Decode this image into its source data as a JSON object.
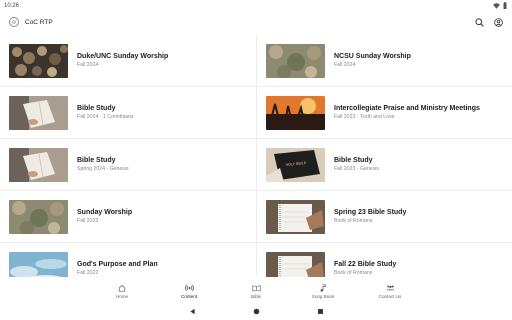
{
  "status": {
    "time": "10:26"
  },
  "app": {
    "title": "CoC RTP",
    "logo_icon": "coc-logo-icon"
  },
  "top_actions": [
    {
      "icon": "search-icon"
    },
    {
      "icon": "account-icon"
    }
  ],
  "left_items": [
    {
      "title": "Duke/UNC Sunday Worship",
      "subtitle": "Fall 2024",
      "thumb": "logs"
    },
    {
      "title": "Bible Study",
      "subtitle": "Fall 2024 - 1 Corinthians",
      "thumb": "reading"
    },
    {
      "title": "Bible Study",
      "subtitle": "Spring 2024 - Genesis",
      "thumb": "reading"
    },
    {
      "title": "Sunday Worship",
      "subtitle": "Fall 2023",
      "thumb": "moss"
    },
    {
      "title": "God's Purpose and Plan",
      "subtitle": "Fall 2022",
      "thumb": "sky"
    }
  ],
  "right_items": [
    {
      "title": "NCSU Sunday Worship",
      "subtitle": "Fall 2024",
      "thumb": "moss"
    },
    {
      "title": "Intercollegiate Praise and Ministry Meetings",
      "subtitle": "Fall 2023 - Truth and Love",
      "thumb": "concert"
    },
    {
      "title": "Bible Study",
      "subtitle": "Fall 2023 - Genesis",
      "thumb": "holybible"
    },
    {
      "title": "Spring 23 Bible Study",
      "subtitle": "Book of Romans",
      "thumb": "notebook"
    },
    {
      "title": "Fall 22 Bible Study",
      "subtitle": "Book of Romans",
      "thumb": "notebook"
    }
  ],
  "nav": [
    {
      "label": "Home",
      "icon": "home-icon"
    },
    {
      "label": "Content",
      "icon": "broadcast-icon",
      "active": true
    },
    {
      "label": "Bible",
      "icon": "book-icon"
    },
    {
      "label": "Song Book",
      "icon": "music-note-icon"
    },
    {
      "label": "Contact Us",
      "icon": "contacts-icon"
    }
  ],
  "thumb_label": "HOLY BIBLE"
}
